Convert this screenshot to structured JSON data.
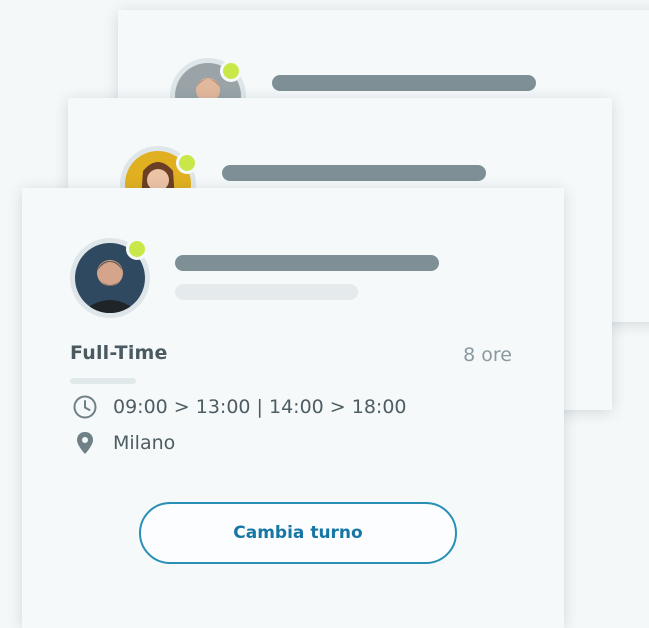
{
  "back_card": {
    "avatar": "person-portrait"
  },
  "middle_card": {
    "avatar": "person-portrait"
  },
  "front_card": {
    "avatar": "person-portrait",
    "shift_type": "Full-Time",
    "hours": "8 ore",
    "schedule": "09:00 > 13:00 | 14:00 > 18:00",
    "location": "Milano",
    "schedule_icon": "clock-icon",
    "location_icon": "map-pin-icon",
    "button_label": "Cambia turno"
  },
  "colors": {
    "status_online": "#c8e84a",
    "accent": "#1676a4",
    "placeholder_dark": "#7e9096",
    "placeholder_light": "#e5eaec"
  }
}
